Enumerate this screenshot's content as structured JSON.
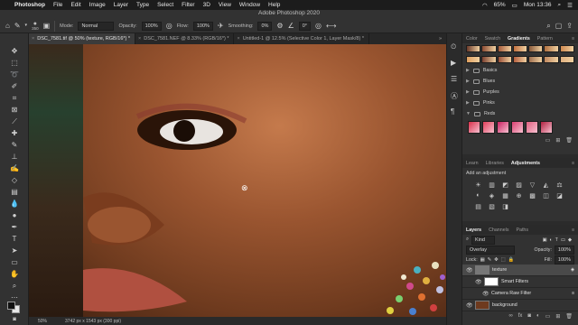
{
  "menubar": {
    "app": "Photoshop",
    "menus": [
      "File",
      "Edit",
      "Image",
      "Layer",
      "Type",
      "Select",
      "Filter",
      "3D",
      "View",
      "Window",
      "Help"
    ],
    "battery": "65%",
    "clock": "Mon 13:36"
  },
  "window": {
    "title": "Adobe Photoshop 2020"
  },
  "options": {
    "brush_size": "350",
    "mode_label": "Mode:",
    "mode_value": "Normal",
    "opacity_label": "Opacity:",
    "opacity_value": "100%",
    "flow_label": "Flow:",
    "flow_value": "100%",
    "smoothing_label": "Smoothing:",
    "smoothing_value": "0%",
    "angle_value": "0°"
  },
  "tabs": [
    {
      "label": "DSC_7581.tif @ 50% (texture, RGB/16*) *",
      "active": true
    },
    {
      "label": "DSC_7581.NEF @ 8.33% (RGB/16*) *",
      "active": false
    },
    {
      "label": "Untitled-1 @ 12.5% (Selective Color 1, Layer Mask/8) *",
      "active": false
    }
  ],
  "status": {
    "zoom": "50%",
    "doc_info": "3742 px x 1543 px (300 ppi)"
  },
  "gradients_panel": {
    "tabs": [
      "Color",
      "Swatch",
      "Gradients",
      "Pattern"
    ],
    "active_tab": "Gradients",
    "folders": [
      "Basics",
      "Blues",
      "Purples",
      "Pinks",
      "Reds"
    ],
    "top_colors": [
      "#6b3a2a",
      "#8a4a32",
      "#a65a3a",
      "#c2703f",
      "#8a5a3a",
      "#b07040",
      "#d08a50",
      "#e0a060",
      "#7a4030",
      "#9a5038",
      "#b66040",
      "#a07050",
      "#c08860",
      "#e0b080"
    ],
    "red_colors": [
      "#d8304a",
      "#e0405a",
      "#c82060",
      "#d84070",
      "#e06080",
      "#b02040"
    ]
  },
  "adjustments_panel": {
    "tabs": [
      "Learn",
      "Libraries",
      "Adjustments"
    ],
    "active_tab": "Adjustments",
    "add_label": "Add an adjustment",
    "icons": [
      "☀",
      "▥",
      "◩",
      "▨",
      "▽",
      "◭",
      "⚖",
      "◐",
      "◈",
      "▦",
      "⊕",
      "▩",
      "◫",
      "◪",
      "▤",
      "▧",
      "◨"
    ]
  },
  "layers_panel": {
    "tabs": [
      "Layers",
      "Channels",
      "Paths"
    ],
    "active_tab": "Layers",
    "filter_kind": "Kind",
    "blend_mode": "Overlay",
    "opacity_label": "Opacity:",
    "opacity_value": "100%",
    "lock_label": "Lock:",
    "fill_label": "Fill:",
    "fill_value": "100%",
    "layers": [
      {
        "name": "texture",
        "selected": true
      },
      {
        "name": "Smart Filters",
        "selected": false
      },
      {
        "name": "Camera Raw Filter",
        "selected": false
      },
      {
        "name": "background",
        "selected": false
      }
    ]
  }
}
